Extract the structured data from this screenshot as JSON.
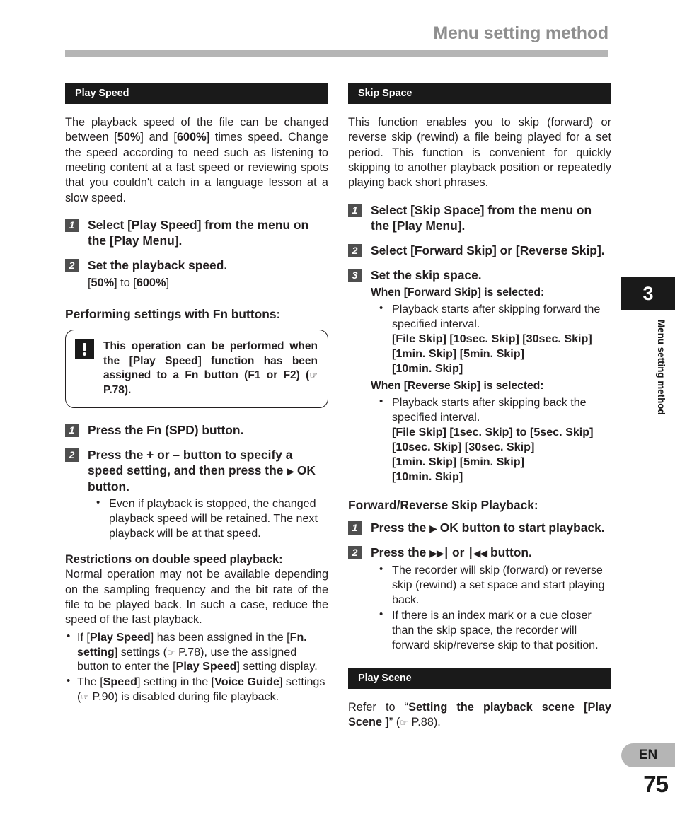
{
  "header": {
    "title": "Menu setting method"
  },
  "chapter": {
    "number": "3",
    "label": "Menu setting method"
  },
  "footer": {
    "language": "EN",
    "page_number": "75"
  },
  "left_column": {
    "section_title": "Play Speed",
    "intro": "The playback speed of the file can be changed between [50%] and [600%] times speed. Change the speed according to need such as listening to meeting content at a fast speed or reviewing spots that you couldn't catch in a language lesson at a slow speed.",
    "intro_html": "The playback speed of the file can be changed between [<b>50%</b>] and [<b>600%</b>] times speed. Change the speed according to need such as listening to meeting content at a fast speed or reviewing spots that you couldn't catch in a language lesson at a slow speed.",
    "steps": [
      {
        "number": "1",
        "text_html": "Select [<b>Play Speed</b>] from the menu on the [<b>Play Menu</b>]."
      },
      {
        "number": "2",
        "text_html": "Set the playback speed.",
        "sub_html": "[<b>50%</b>] to [<b>600%</b>]"
      }
    ],
    "fn_heading": "Performing settings with Fn buttons:",
    "note_html": "This operation can be performed when the [<b>Play Speed</b>] function has been assigned to a <b>Fn</b> button (<b>F1</b> or <b>F2</b>) (<span class=\"hand\">&#9758;</span> <b>P.78</b>).",
    "fn_steps": [
      {
        "number": "1",
        "text_html": "Press the <b>Fn</b> (<b>SPD</b>) button."
      },
      {
        "number": "2",
        "text_html": "Press the + or &#8211; button to specify a speed setting, and then press the <span class=\"glyph\">&#9654;</span> OK button.",
        "bullets_html": [
          "Even if playback is stopped, the changed playback speed will be retained. The next playback will be at that speed."
        ]
      }
    ],
    "restrictions_heading": "Restrictions on double speed playback:",
    "restrictions_text": "Normal operation may not be available depending on the sampling frequency and the bit rate of the file to be played back. In such a case, reduce the speed of the fast playback.",
    "restriction_bullets_html": [
      "If [<b>Play Speed</b>] has been assigned in the [<b>Fn. setting</b>] settings (<span class=\"hand\">&#9758;</span> P.78), use the assigned button to enter the [<b>Play Speed</b>] setting display.",
      "The [<b>Speed</b>] setting in the [<b>Voice Guide</b>] settings (<span class=\"hand\">&#9758;</span> P.90) is disabled during file playback."
    ]
  },
  "right_column": {
    "section_title": "Skip Space",
    "intro": "This function enables you to skip (forward) or reverse skip (rewind) a file being played for a set period. This function is convenient for quickly skipping to another playback position or repeatedly playing back short phrases.",
    "steps": [
      {
        "number": "1",
        "text_html": "Select [<b>Skip Space</b>] from the menu on the [<b>Play Menu</b>]."
      },
      {
        "number": "2",
        "text_html": "Select [<b>Forward Skip</b>] or [<b>Reverse Skip</b>]."
      },
      {
        "number": "3",
        "text_html": "Set the skip space."
      }
    ],
    "forward_heading_html": "When [<b>Forward Skip</b>] is selected:",
    "forward_bullet": "Playback starts after skipping forward the specified interval.",
    "forward_options_html": "[<b>File Skip</b>] [<b>10sec. Skip</b>] [<b>30sec. Skip</b>]<br>[<b>1min. Skip</b>] [<b>5min. Skip</b>]<br>[<b>10min. Skip</b>]",
    "reverse_heading_html": "When [<b>Reverse Skip</b>] is selected:",
    "reverse_bullet": "Playback starts after skipping back the specified interval.",
    "reverse_options_html": "[<b>File Skip</b>] [<b>1sec. Skip</b>] to [<b>5sec. Skip</b>]<br>[<b>10sec. Skip</b>] [<b>30sec. Skip</b>]<br>[<b>1min. Skip</b>] [<b>5min. Skip</b>]<br>[<b>10min. Skip</b>]",
    "playback_heading": "Forward/Reverse Skip Playback:",
    "playback_steps": [
      {
        "number": "1",
        "text_html": "Press the <span class=\"glyph\">&#9654;</span> OK button to start playback."
      },
      {
        "number": "2",
        "text_html": "Press the <span class=\"glyph\">&#9654;&#9654;&#9475;</span> or <span class=\"glyph\">&#9475;&#9664;&#9664;</span> button.",
        "bullets_html": [
          "The recorder will skip (forward) or reverse skip (rewind) a set space and start playing back.",
          "If there is an index mark or a cue closer than the skip space, the recorder will forward skip/reverse skip to that position."
        ]
      }
    ],
    "play_scene": {
      "section_title": "Play Scene",
      "text_html": "Refer to &#8220;<b>Setting the playback scene [Play Scene ]</b>&#8221; (<span class=\"hand\">&#9758;</span> P.88)."
    }
  }
}
